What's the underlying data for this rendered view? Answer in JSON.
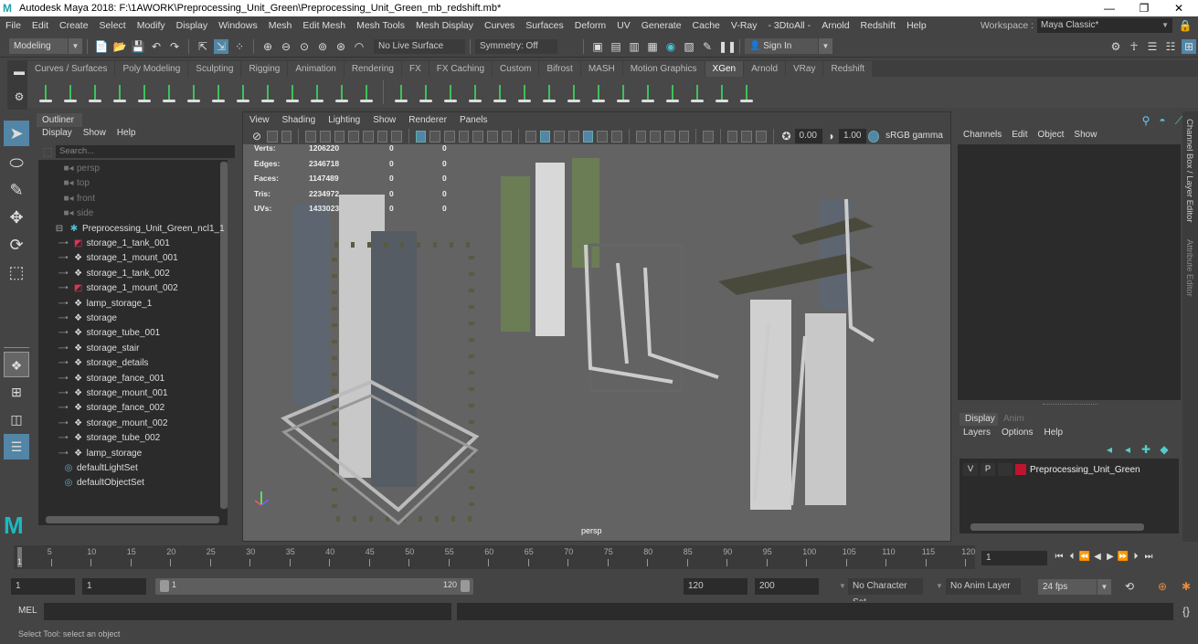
{
  "window": {
    "title": "Autodesk Maya 2018: F:\\1AWORK\\Preprocessing_Unit_Green\\Preprocessing_Unit_Green_mb_redshift.mb*",
    "controls": [
      "minimize",
      "maximize",
      "close"
    ]
  },
  "menubar": [
    "File",
    "Edit",
    "Create",
    "Select",
    "Modify",
    "Display",
    "Windows",
    "Mesh",
    "Edit Mesh",
    "Mesh Tools",
    "Mesh Display",
    "Curves",
    "Surfaces",
    "Deform",
    "UV",
    "Generate",
    "Cache",
    "V-Ray",
    "- 3DtoAll -",
    "Arnold",
    "Redshift",
    "Help"
  ],
  "workspace": {
    "label": "Workspace :",
    "value": "Maya Classic*"
  },
  "statusline": {
    "mode": "Modeling",
    "live_surface": "No Live Surface",
    "symmetry": "Symmetry: Off",
    "sign_in": "Sign In"
  },
  "shelf": {
    "tabs": [
      "Curves / Surfaces",
      "Poly Modeling",
      "Sculpting",
      "Rigging",
      "Animation",
      "Rendering",
      "FX",
      "FX Caching",
      "Custom",
      "Bifrost",
      "MASH",
      "Motion Graphics",
      "XGen",
      "Arnold",
      "VRay",
      "Redshift"
    ],
    "active_tab": "XGen"
  },
  "outliner": {
    "tab": "Outliner",
    "menu": [
      "Display",
      "Show",
      "Help"
    ],
    "search_placeholder": "Search...",
    "cameras": [
      "persp",
      "top",
      "front",
      "side"
    ],
    "group": "Preprocessing_Unit_Green_ncl1_1",
    "children": [
      {
        "name": "storage_1_tank_001",
        "icon": "mesh-red"
      },
      {
        "name": "storage_1_mount_001",
        "icon": "transform"
      },
      {
        "name": "storage_1_tank_002",
        "icon": "transform"
      },
      {
        "name": "storage_1_mount_002",
        "icon": "mesh-red"
      },
      {
        "name": "lamp_storage_1",
        "icon": "transform"
      },
      {
        "name": "storage",
        "icon": "transform"
      },
      {
        "name": "storage_tube_001",
        "icon": "transform"
      },
      {
        "name": "storage_stair",
        "icon": "transform"
      },
      {
        "name": "storage_details",
        "icon": "transform"
      },
      {
        "name": "storage_fance_001",
        "icon": "transform"
      },
      {
        "name": "storage_mount_001",
        "icon": "transform"
      },
      {
        "name": "storage_fance_002",
        "icon": "transform"
      },
      {
        "name": "storage_mount_002",
        "icon": "transform"
      },
      {
        "name": "storage_tube_002",
        "icon": "transform"
      },
      {
        "name": "lamp_storage",
        "icon": "transform"
      }
    ],
    "sets": [
      "defaultLightSet",
      "defaultObjectSet"
    ]
  },
  "viewport": {
    "menu": [
      "View",
      "Shading",
      "Lighting",
      "Show",
      "Renderer",
      "Panels"
    ],
    "exposure": "0.00",
    "gamma": "1.00",
    "color_space": "sRGB gamma",
    "camera_label": "persp",
    "hud": [
      {
        "label": "Verts:",
        "value": "1206220",
        "sel": "0",
        "comp": "0"
      },
      {
        "label": "Edges:",
        "value": "2346718",
        "sel": "0",
        "comp": "0"
      },
      {
        "label": "Faces:",
        "value": "1147489",
        "sel": "0",
        "comp": "0"
      },
      {
        "label": "Tris:",
        "value": "2234972",
        "sel": "0",
        "comp": "0"
      },
      {
        "label": "UVs:",
        "value": "1433023",
        "sel": "0",
        "comp": "0"
      }
    ]
  },
  "channelbox": {
    "menu": [
      "Channels",
      "Edit",
      "Object",
      "Show"
    ],
    "side_tabs": [
      "Channel Box / Layer Editor",
      "Attribute Editor"
    ]
  },
  "layereditor": {
    "tabs": [
      "Display",
      "Anim"
    ],
    "menu": [
      "Layers",
      "Options",
      "Help"
    ],
    "layers": [
      {
        "v": "V",
        "p": "P",
        "name": "Preprocessing_Unit_Green",
        "color": "#c0142e"
      }
    ]
  },
  "timeline": {
    "ticks": [
      "5",
      "10",
      "15",
      "20",
      "25",
      "30",
      "35",
      "40",
      "45",
      "50",
      "55",
      "60",
      "65",
      "70",
      "75",
      "80",
      "85",
      "90",
      "95",
      "100",
      "105",
      "110",
      "115",
      "120"
    ],
    "current_frame_marker": "1",
    "current_frame": "1"
  },
  "range": {
    "start": "1",
    "playback_start": "1",
    "slider_start": "1",
    "slider_end": "120",
    "playback_end": "120",
    "end": "200",
    "character_set": "No Character Set",
    "anim_layer": "No Anim Layer",
    "fps": "24 fps"
  },
  "cmdline": {
    "label": "MEL"
  },
  "helpline": "Select Tool: select an object"
}
